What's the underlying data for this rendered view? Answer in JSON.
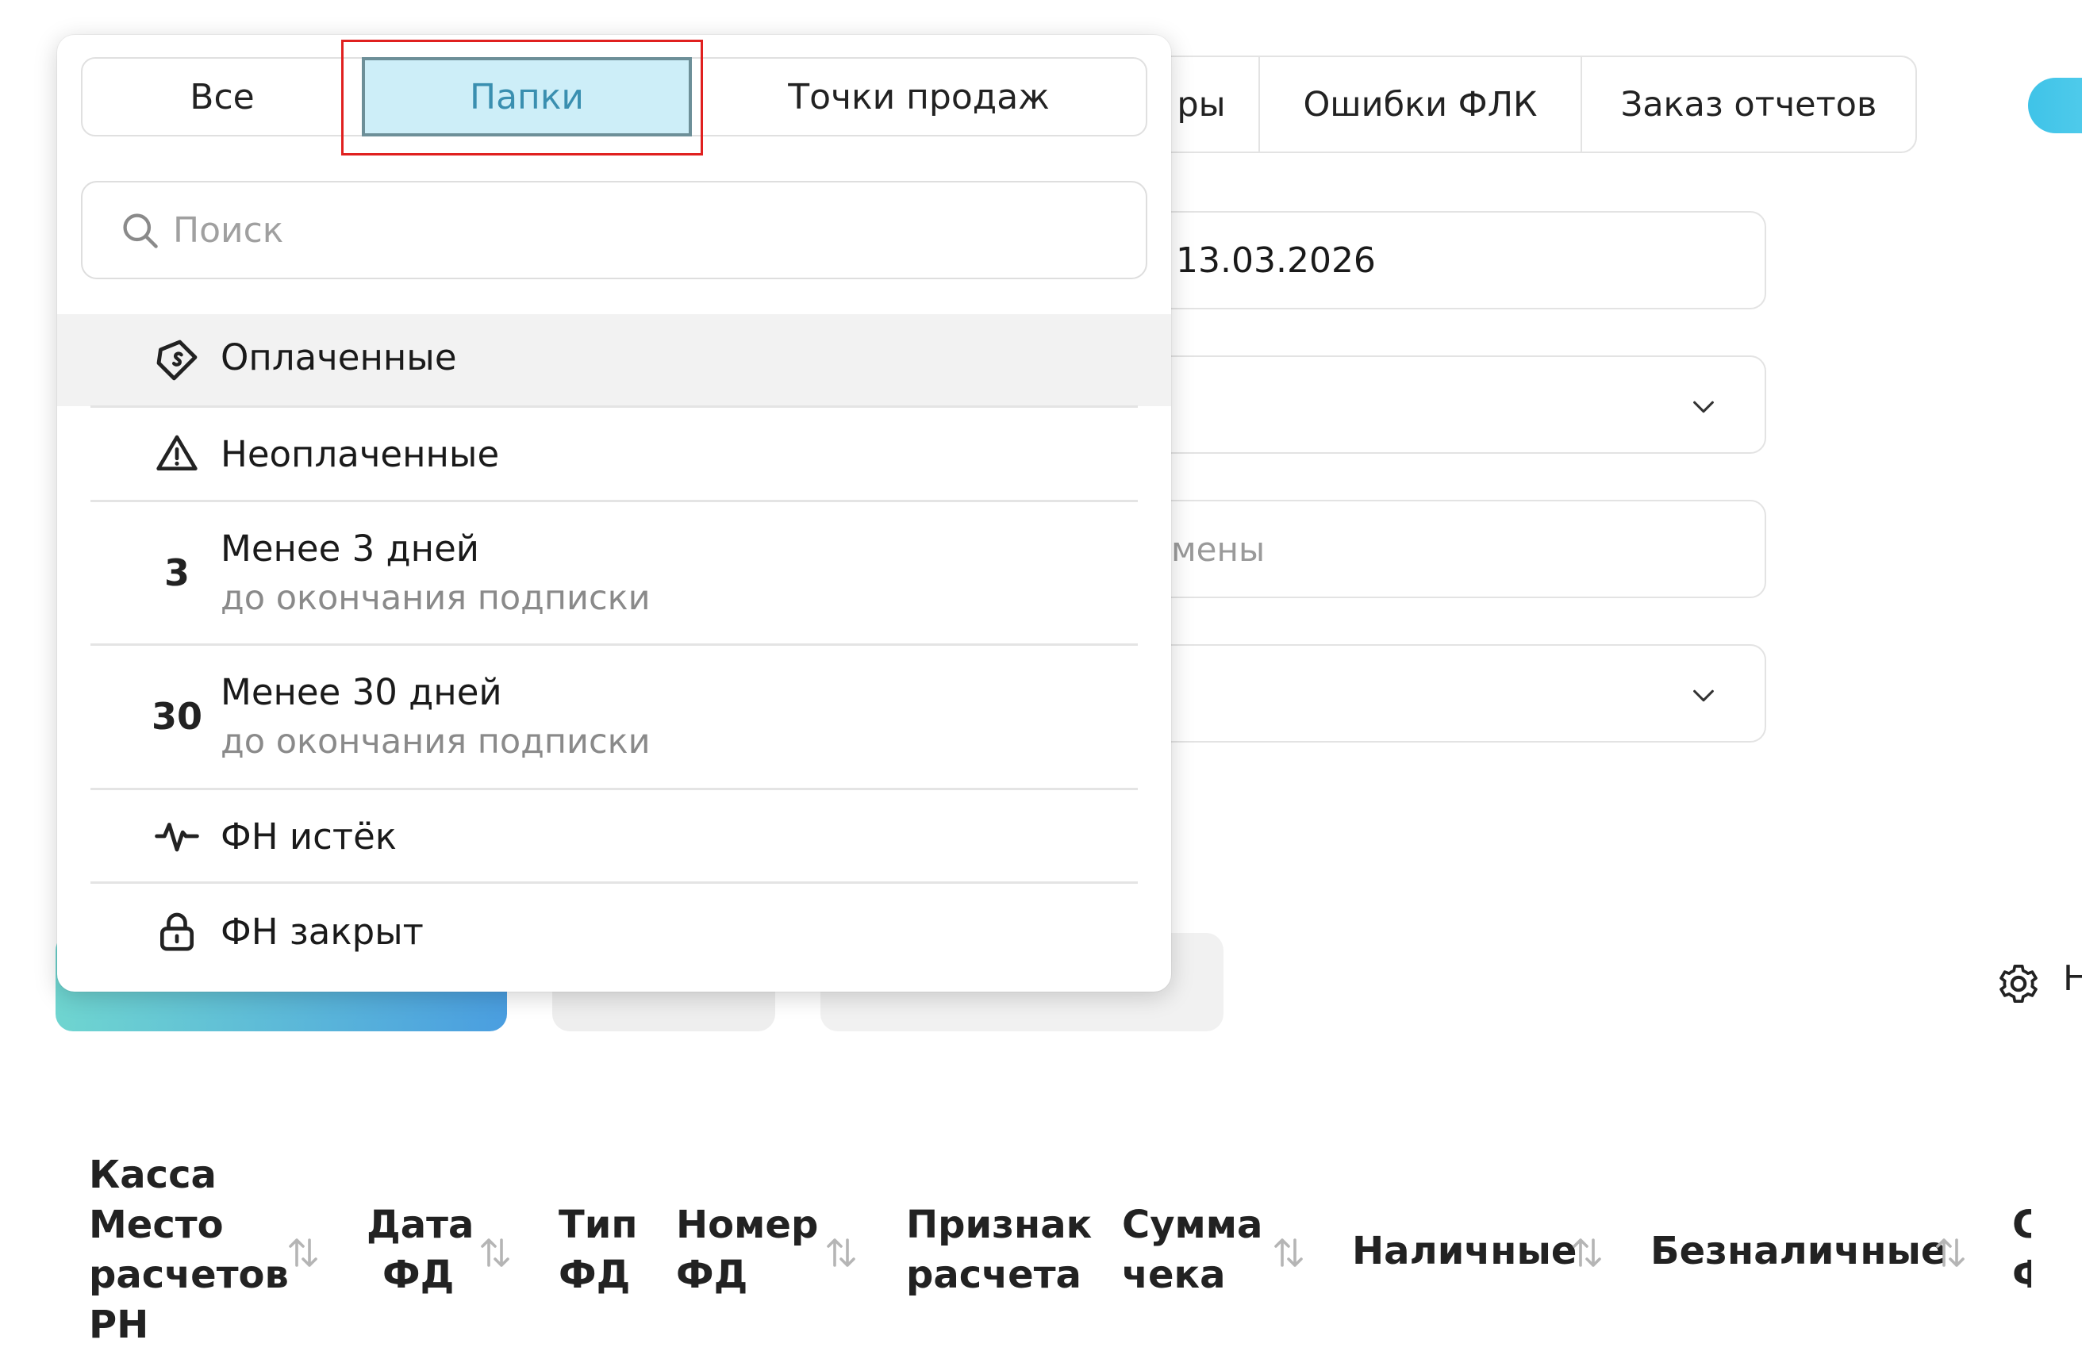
{
  "background": {
    "tabs": [
      {
        "label": "ры"
      },
      {
        "label": "Ошибки ФЛК"
      },
      {
        "label": "Заказ отчетов"
      }
    ],
    "date_field_value": "13.03.2026",
    "shift_field_placeholder": "мены",
    "buttons": {
      "save_template_label": "н",
      "settings_letter": "Н"
    }
  },
  "table": {
    "columns": [
      {
        "label_lines": [
          "Касса",
          "Место",
          "расчетов",
          "РН"
        ],
        "sortable": true
      },
      {
        "label_lines": [
          "Дата",
          "ФД"
        ],
        "sortable": true
      },
      {
        "label_lines": [
          "Тип",
          "ФД"
        ],
        "sortable": false
      },
      {
        "label_lines": [
          "Номер",
          "ФД"
        ],
        "sortable": true
      },
      {
        "label_lines": [
          "Признак",
          "расчета"
        ],
        "sortable": false
      },
      {
        "label_lines": [
          "Сумма",
          "чека"
        ],
        "sortable": true
      },
      {
        "label_lines": [
          "Наличные"
        ],
        "sortable": true
      },
      {
        "label_lines": [
          "Безналичные"
        ],
        "sortable": true
      },
      {
        "label_lines": [
          "С",
          "Ф"
        ],
        "sortable": false
      }
    ]
  },
  "dropdown": {
    "segments": [
      {
        "label": "Все",
        "selected": false
      },
      {
        "label": "Папки",
        "selected": true
      },
      {
        "label": "Точки продаж",
        "selected": false
      }
    ],
    "search": {
      "placeholder": "Поиск",
      "value": ""
    },
    "items": [
      {
        "icon": "paid-tag-icon",
        "label": "Оплаченные",
        "highlighted": true
      },
      {
        "icon": "warning-triangle-icon",
        "label": "Неоплаченные"
      },
      {
        "badge": "3",
        "label": "Менее 3 дней",
        "sublabel": "до окончания подписки"
      },
      {
        "badge": "30",
        "label": "Менее 30 дней",
        "sublabel": "до окончания подписки"
      },
      {
        "icon": "pulse-icon",
        "label": "ФН истёк"
      },
      {
        "icon": "lock-icon",
        "label": "ФН закрыт"
      }
    ]
  },
  "colors": {
    "selected_segment_bg": "#cdeef8",
    "selected_segment_text": "#3a8fb0",
    "highlight_box": "#e0201f",
    "primary_button_gradient": [
      "#6fd5d0",
      "#4a9ee0"
    ]
  }
}
